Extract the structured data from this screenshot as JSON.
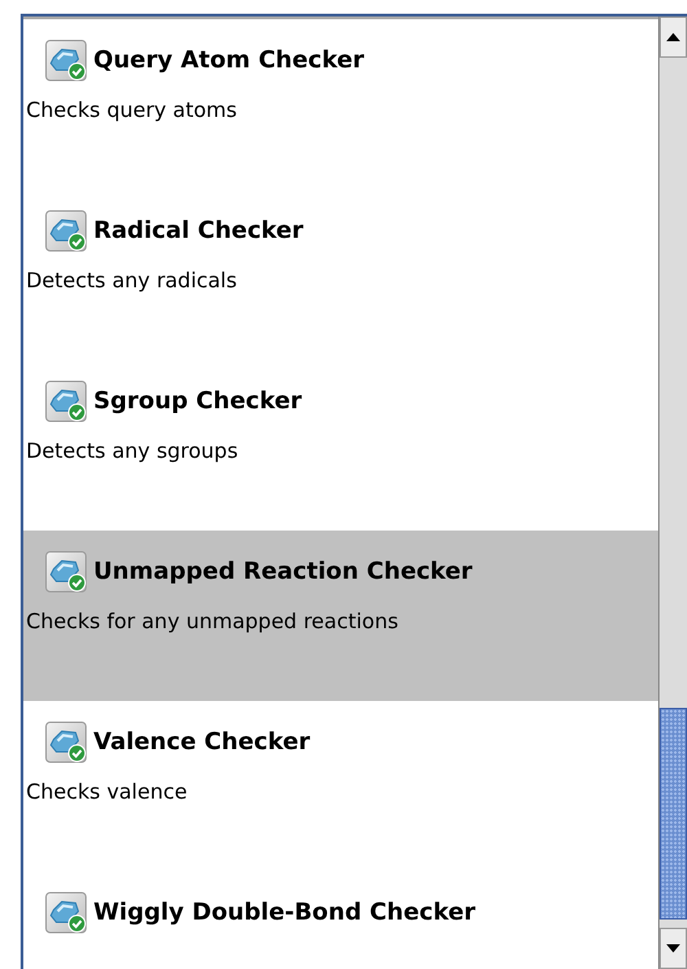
{
  "checkers": [
    {
      "title": "Query Atom Checker",
      "description": "Checks query atoms",
      "selected": false
    },
    {
      "title": "Radical Checker",
      "description": "Detects any radicals",
      "selected": false
    },
    {
      "title": "Sgroup Checker",
      "description": "Detects any sgroups",
      "selected": false
    },
    {
      "title": "Unmapped Reaction Checker",
      "description": "Checks for any unmapped reactions",
      "selected": true
    },
    {
      "title": "Valence Checker",
      "description": "Checks valence",
      "selected": false
    },
    {
      "title": "Wiggly Double-Bond Checker",
      "selected": false
    }
  ]
}
